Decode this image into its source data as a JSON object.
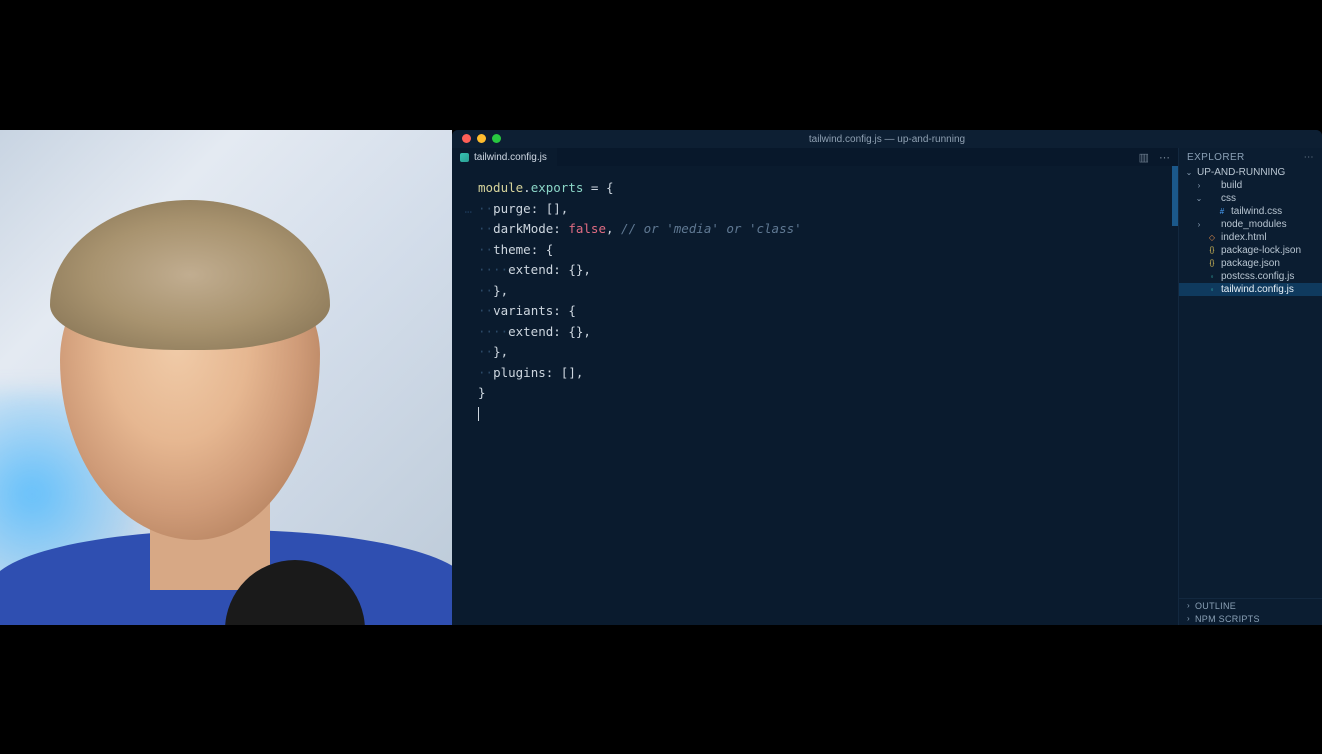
{
  "window": {
    "title": "tailwind.config.js — up-and-running"
  },
  "tab": {
    "filename": "tailwind.config.js"
  },
  "sidebar": {
    "title": "EXPLORER",
    "project": "UP-AND-RUNNING",
    "tree": [
      {
        "label": "build",
        "kind": "folder",
        "indent": 1,
        "chev": "›"
      },
      {
        "label": "css",
        "kind": "folder",
        "indent": 1,
        "chev": "⌄"
      },
      {
        "label": "tailwind.css",
        "kind": "css",
        "indent": 2
      },
      {
        "label": "node_modules",
        "kind": "folder",
        "indent": 1,
        "chev": "›"
      },
      {
        "label": "index.html",
        "kind": "html",
        "indent": 1
      },
      {
        "label": "package-lock.json",
        "kind": "jsonY",
        "indent": 1
      },
      {
        "label": "package.json",
        "kind": "jsonY",
        "indent": 1
      },
      {
        "label": "postcss.config.js",
        "kind": "js",
        "indent": 1
      },
      {
        "label": "tailwind.config.js",
        "kind": "js",
        "indent": 1,
        "selected": true
      }
    ],
    "panels": {
      "outline": "OUTLINE",
      "npm": "NPM SCRIPTS"
    }
  },
  "code": {
    "lines": [
      {
        "segs": [
          {
            "t": "module",
            "c": "k-module"
          },
          {
            "t": ".",
            "c": "punct"
          },
          {
            "t": "exports",
            "c": "k-exports"
          },
          {
            "t": " = {",
            "c": "punct"
          }
        ]
      },
      {
        "ws": 2,
        "segs": [
          {
            "t": "purge",
            "c": "prop"
          },
          {
            "t": ": [],",
            "c": "punct"
          }
        ],
        "pre": "…"
      },
      {
        "ws": 2,
        "segs": [
          {
            "t": "darkMode",
            "c": "prop"
          },
          {
            "t": ": ",
            "c": "punct"
          },
          {
            "t": "false",
            "c": "bool"
          },
          {
            "t": ", ",
            "c": "punct"
          },
          {
            "t": "// or 'media' or 'class'",
            "c": "comment"
          }
        ]
      },
      {
        "ws": 2,
        "segs": [
          {
            "t": "theme",
            "c": "prop"
          },
          {
            "t": ": {",
            "c": "punct"
          }
        ]
      },
      {
        "ws": 4,
        "segs": [
          {
            "t": "extend",
            "c": "prop"
          },
          {
            "t": ": {},",
            "c": "punct"
          }
        ]
      },
      {
        "ws": 2,
        "segs": [
          {
            "t": "},",
            "c": "punct"
          }
        ]
      },
      {
        "ws": 2,
        "segs": [
          {
            "t": "variants",
            "c": "prop"
          },
          {
            "t": ": {",
            "c": "punct"
          }
        ]
      },
      {
        "ws": 4,
        "segs": [
          {
            "t": "extend",
            "c": "prop"
          },
          {
            "t": ": {},",
            "c": "punct"
          }
        ]
      },
      {
        "ws": 2,
        "segs": [
          {
            "t": "},",
            "c": "punct"
          }
        ]
      },
      {
        "ws": 2,
        "segs": [
          {
            "t": "plugins",
            "c": "prop"
          },
          {
            "t": ": [],",
            "c": "punct"
          }
        ]
      },
      {
        "segs": [
          {
            "t": "}",
            "c": "punct"
          }
        ]
      },
      {
        "cursor": true,
        "segs": []
      }
    ]
  }
}
